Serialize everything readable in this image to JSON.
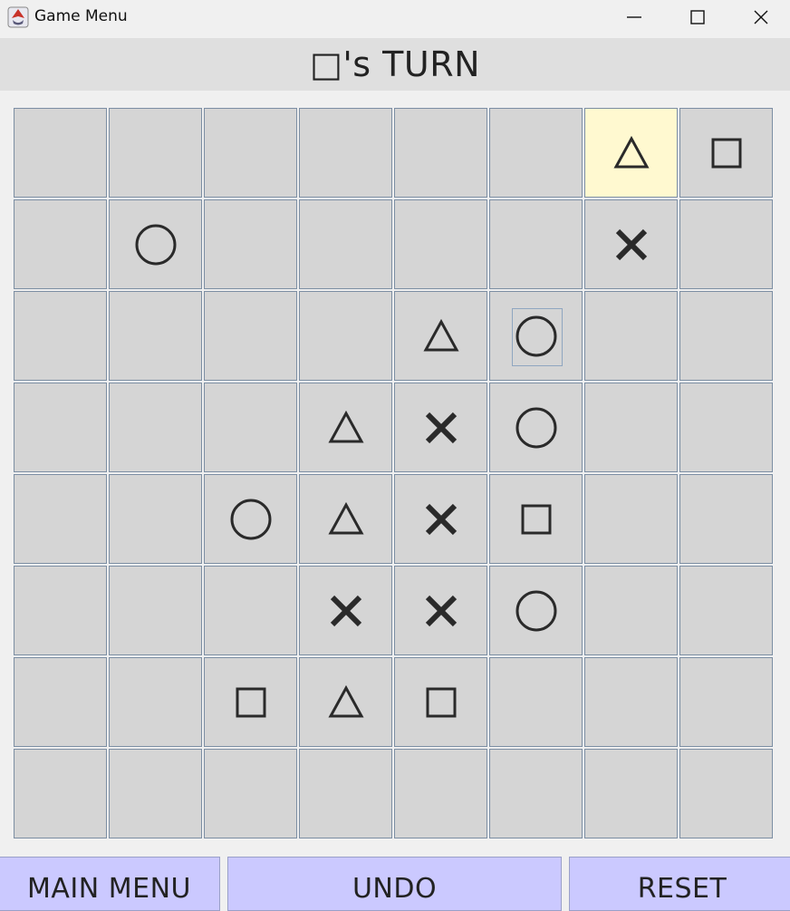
{
  "window": {
    "title": "Game Menu"
  },
  "turn": {
    "text": "□'s TURN"
  },
  "board": {
    "rows": [
      [
        "",
        "",
        "",
        "",
        "",
        "",
        "triangle",
        "square"
      ],
      [
        "",
        "circle",
        "",
        "",
        "",
        "",
        "x",
        ""
      ],
      [
        "",
        "",
        "",
        "",
        "triangle",
        "circle",
        "",
        ""
      ],
      [
        "",
        "",
        "",
        "triangle",
        "x",
        "circle",
        "",
        ""
      ],
      [
        "",
        "",
        "circle",
        "triangle",
        "x",
        "square",
        "",
        ""
      ],
      [
        "",
        "",
        "",
        "x",
        "x",
        "circle",
        "",
        ""
      ],
      [
        "",
        "",
        "square",
        "triangle",
        "square",
        "",
        "",
        ""
      ],
      [
        "",
        "",
        "",
        "",
        "",
        "",
        "",
        ""
      ]
    ],
    "highlighted_cell": [
      0,
      6
    ],
    "focused_cell": [
      2,
      5
    ]
  },
  "buttons": {
    "main_menu": "MAIN MENU",
    "undo": "UNDO",
    "reset": "RESET"
  },
  "colors": {
    "cell": "#d5d5d5",
    "highlight": "#fff9d0",
    "button": "#cbc9ff",
    "piece": "#2a2a2a"
  }
}
